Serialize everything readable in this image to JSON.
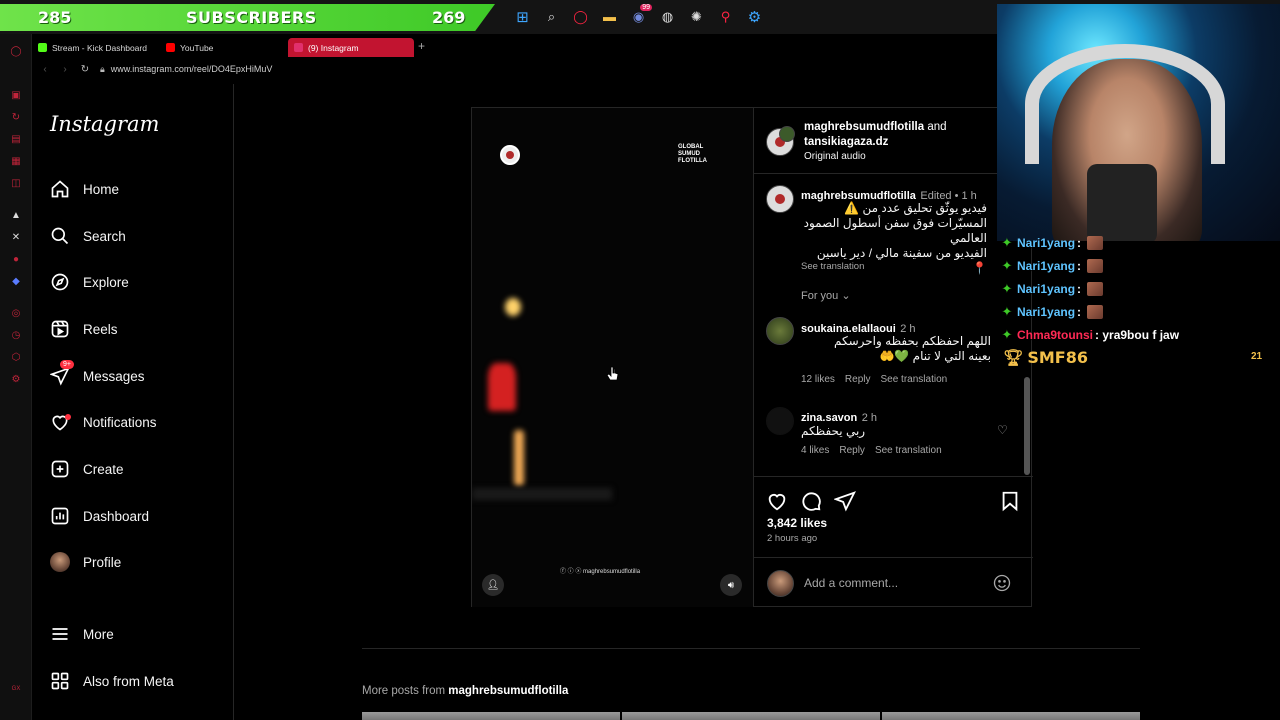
{
  "banner": {
    "left_count": "285",
    "label": "SUBSCRIBERS",
    "right_count": "269"
  },
  "taskbar": {
    "discord_badge": "99"
  },
  "browser": {
    "tabs": [
      {
        "title": "Stream - Kick Dashboard",
        "fav_color": "#53fc18"
      },
      {
        "title": "YouTube",
        "fav_color": "#ff0000"
      },
      {
        "title": "(9) Instagram",
        "fav_color": "#e1306c"
      }
    ],
    "url": "www.instagram.com/reel/DO4EpxHiMuV",
    "accent": "#c21430"
  },
  "instagram": {
    "logo": "Instagram",
    "nav": {
      "home": "Home",
      "search": "Search",
      "explore": "Explore",
      "reels": "Reels",
      "messages": "Messages",
      "messages_badge": "9+",
      "notifications": "Notifications",
      "create": "Create",
      "dashboard": "Dashboard",
      "profile": "Profile",
      "more": "More",
      "meta": "Also from Meta"
    },
    "video": {
      "logo_text_1": "GLOBAL",
      "logo_text_2": "SUMUD",
      "logo_text_3": "FLOTILLA",
      "watermark": "maghrebsumudflotilla"
    },
    "post": {
      "author1": "maghrebsumudflotilla",
      "and_text": "and",
      "author2": "tansikiagaza.dz",
      "audio": "Original audio",
      "caption": {
        "user": "maghrebsumudflotilla",
        "status": "Edited • 1 h",
        "line1": "فيديو يوثّق تحليق عدد من ⚠️",
        "line2": "المسيّرات فوق سفن أسطول الصمود",
        "line3": "العالمي",
        "line4": "الفيديو من سفينة مالي / دير ياسين 📍",
        "translate": "See translation"
      },
      "for_you": "For you",
      "comments": [
        {
          "user": "soukaina.elallaoui",
          "time": "2 h",
          "line1": "اللهم احفظكم بحفظه واحرسكم",
          "line2": "بعينه التي لا تنام 💚🤲",
          "likes": "12 likes",
          "reply": "Reply",
          "translate": "See translation"
        },
        {
          "user": "zina.savon",
          "time": "2 h",
          "line1": "ربي يحفظكم",
          "likes": "4 likes",
          "reply": "Reply",
          "translate": "See translation"
        }
      ],
      "likes": "3,842 likes",
      "posted": "2 hours ago",
      "comment_placeholder": "Add a comment..."
    },
    "more_posts_prefix": "More posts from",
    "more_posts_user": "maghrebsumudflotilla"
  },
  "chat": {
    "lines": [
      {
        "user": "Nari1yang",
        "text": ":"
      },
      {
        "user": "Nari1yang",
        "text": ":"
      },
      {
        "user": "Nari1yang",
        "text": ":"
      },
      {
        "user": "Nari1yang",
        "text": ":"
      },
      {
        "user": "Chma9tounsi",
        "text": ": yra9bou f jaw"
      }
    ],
    "top_donor": "SMF86",
    "top_donor_count": "21"
  }
}
